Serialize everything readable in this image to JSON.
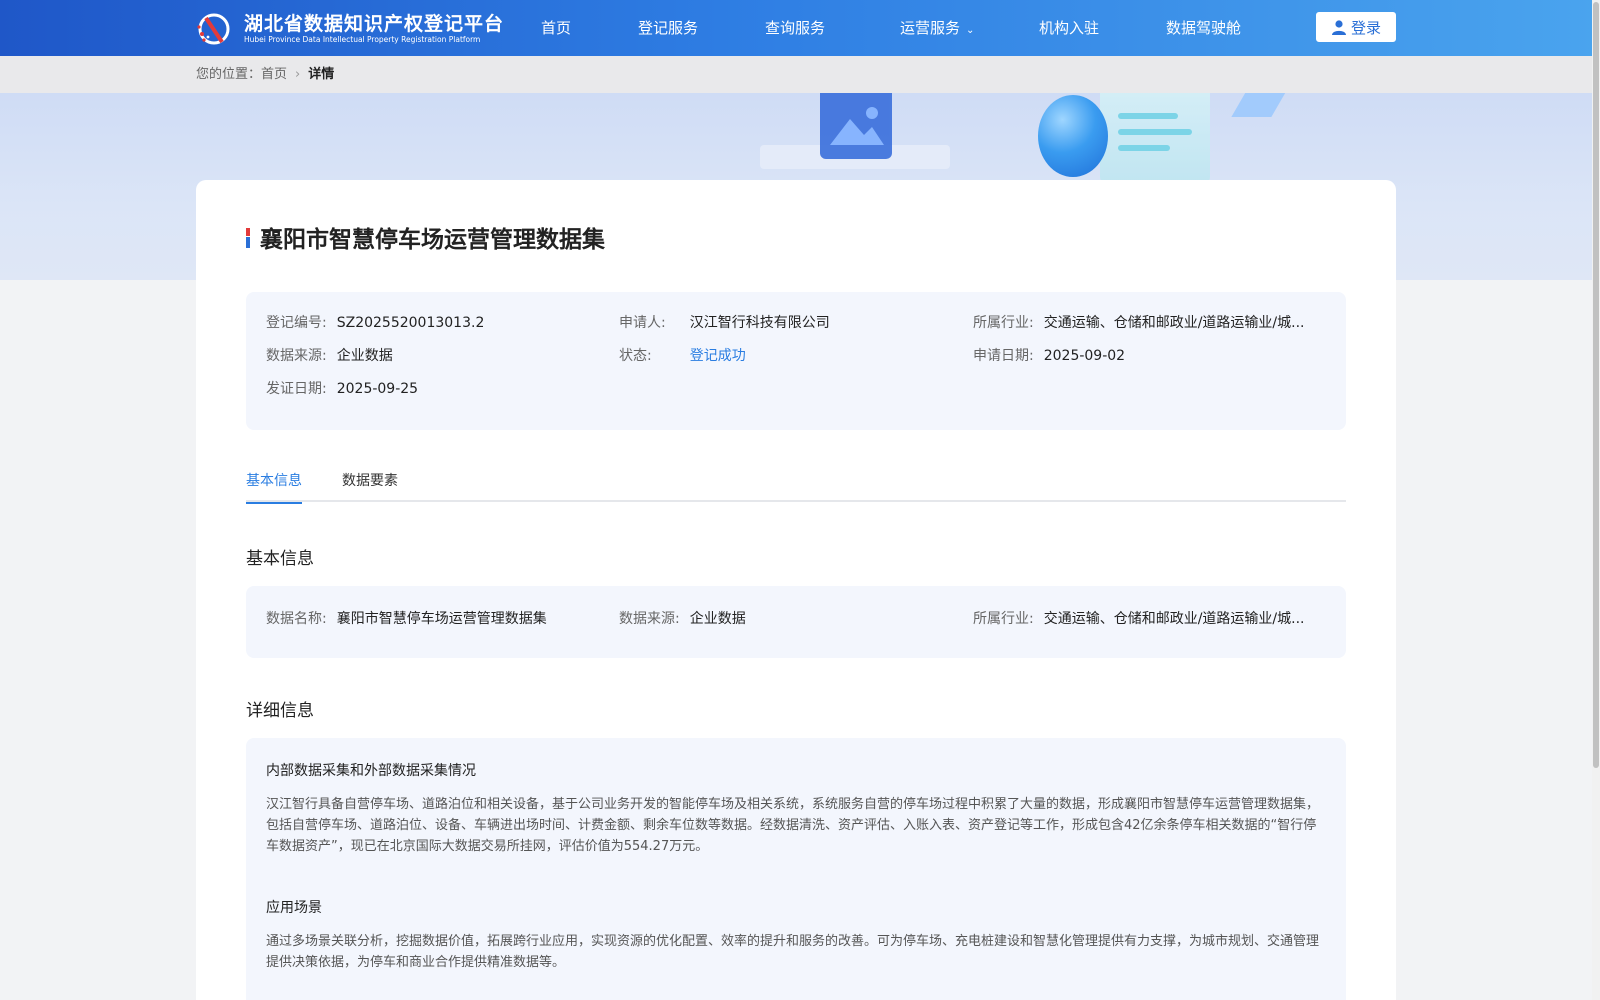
{
  "header": {
    "logo_cn": "湖北省数据知识产权登记平台",
    "logo_en": "Hubei Province Data Intellectual Property Registration Platform",
    "nav": [
      {
        "label": "首页"
      },
      {
        "label": "登记服务"
      },
      {
        "label": "查询服务"
      },
      {
        "label": "运营服务"
      },
      {
        "label": "机构入驻"
      },
      {
        "label": "数据驾驶舱"
      }
    ],
    "login_label": "登录"
  },
  "breadcrumb": {
    "prefix": "您的位置：",
    "home": "首页",
    "current": "详情"
  },
  "detail": {
    "title": "襄阳市智慧停车场运营管理数据集",
    "summary": [
      {
        "k": "登记编号:",
        "v": "SZ2025520013013.2"
      },
      {
        "k": "申请人:",
        "v": "汉江智行科技有限公司"
      },
      {
        "k": "所属行业:",
        "v": "交通运输、仓储和邮政业/道路运输业/城..."
      },
      {
        "k": "数据来源:",
        "v": "企业数据"
      },
      {
        "k": "状态:",
        "v": "登记成功"
      },
      {
        "k": "申请日期:",
        "v": "2025-09-02"
      },
      {
        "k": "发证日期:",
        "v": "2025-09-25"
      }
    ],
    "tabs": [
      {
        "label": "基本信息"
      },
      {
        "label": "数据要素"
      }
    ],
    "basic_title": "基本信息",
    "basic": [
      {
        "k": "数据名称:",
        "v": "襄阳市智慧停车场运营管理数据集"
      },
      {
        "k": "数据来源:",
        "v": "企业数据"
      },
      {
        "k": "所属行业:",
        "v": "交通运输、仓储和邮政业/道路运输业/城..."
      }
    ],
    "more_title": "详细信息",
    "collect_title": "内部数据采集和外部数据采集情况",
    "collect_text": "汉江智行具备自营停车场、道路泊位和相关设备，基于公司业务开发的智能停车场及相关系统，系统服务自营的停车场过程中积累了大量的数据，形成襄阳市智慧停车运营管理数据集，包括自营停车场、道路泊位、设备、车辆进出场时间、计费金额、剩余车位数等数据。经数据清洗、资产评估、入账入表、资产登记等工作，形成包含42亿余条停车相关数据的“智行停车数据资产”，现已在北京国际大数据交易所挂网，评估价值为554.27万元。",
    "scene_title": "应用场景",
    "scene_text": "通过多场景关联分析，挖掘数据价值，拓展跨行业应用，实现资源的优化配置、效率的提升和服务的改善。可为停车场、充电桩建设和智慧化管理提供有力支撑，为城市规划、交通管理提供决策依据，为停车和商业合作提供精准数据等。"
  },
  "colors": {
    "primary": "#2a7de1",
    "header_start": "#1f57c8",
    "header_end": "#4aa4ee",
    "panel_bg": "#f3f6fd"
  }
}
